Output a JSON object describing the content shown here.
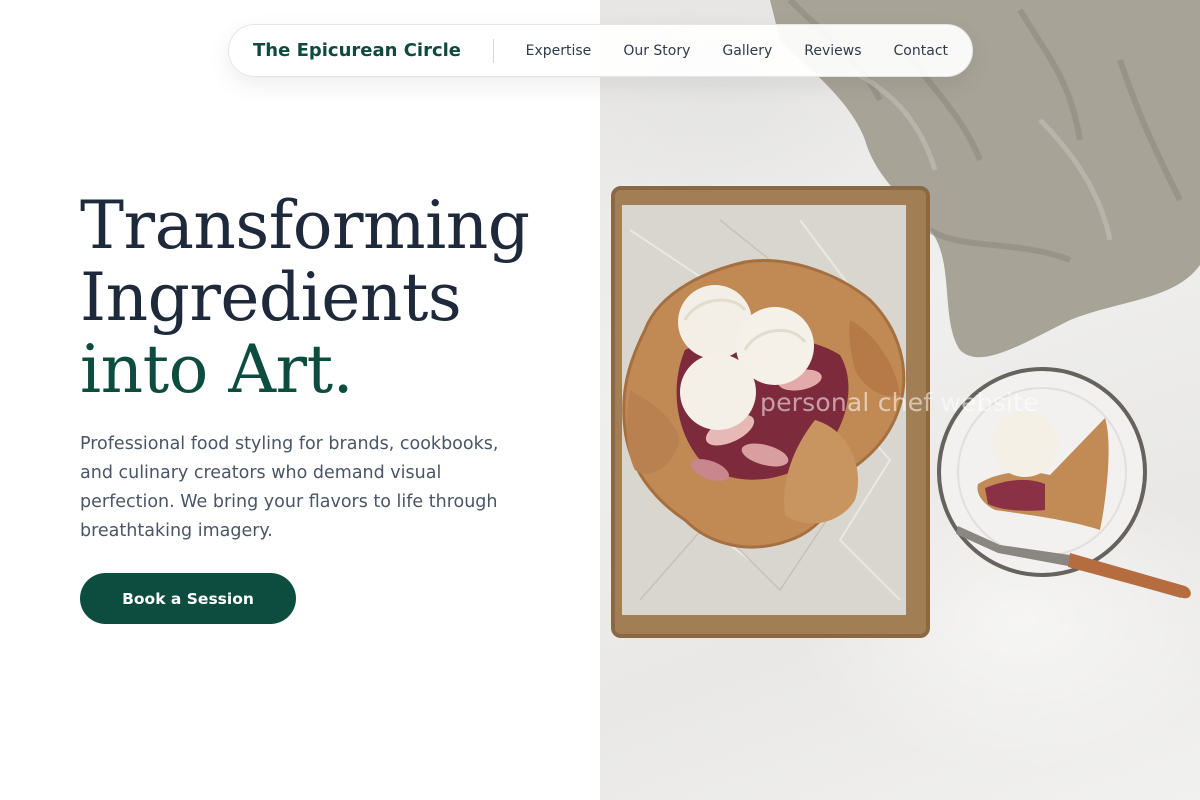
{
  "nav": {
    "brand": "The Epicurean Circle",
    "links": [
      "Expertise",
      "Our Story",
      "Gallery",
      "Reviews",
      "Contact"
    ]
  },
  "hero": {
    "headline_line1": "Transforming",
    "headline_line2": "Ingredients",
    "headline_line3": "into Art.",
    "lede": "Professional food styling for brands, cookbooks, and culinary creators who demand visual perfection. We bring your flavors to life through breathtaking imagery.",
    "cta_label": "Book a Session",
    "image_watermark": "personal chef website"
  },
  "colors": {
    "brand_green": "#0d4d3f",
    "headline_navy": "#1e293b",
    "body_gray": "#4a5566"
  }
}
